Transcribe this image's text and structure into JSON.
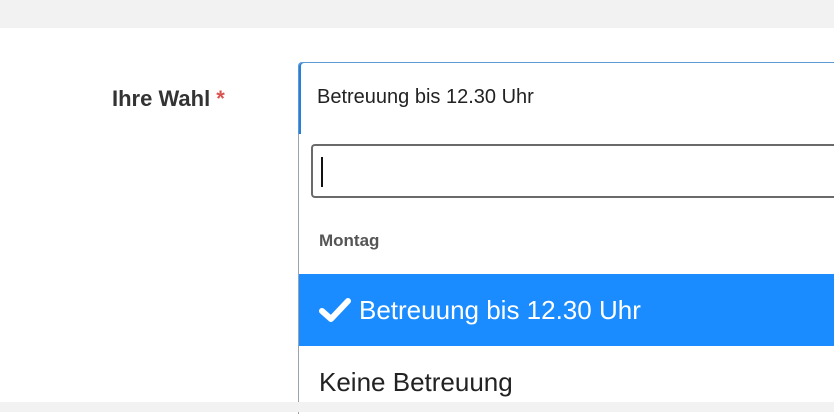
{
  "form": {
    "label": "Ihre Wahl",
    "required_marker": "*"
  },
  "select": {
    "selected_value": "Betreuung bis 12.30 Uhr",
    "search": {
      "value": "",
      "placeholder": ""
    },
    "group_label": "Montag",
    "options": [
      {
        "label": "Betreuung bis 12.30 Uhr",
        "selected": true,
        "icon": "check-icon"
      },
      {
        "label": "Keine Betreuung",
        "selected": false
      }
    ]
  },
  "colors": {
    "highlight": "#1a8cff",
    "required": "#d9534f",
    "focus_border": "#5b9bd5"
  }
}
